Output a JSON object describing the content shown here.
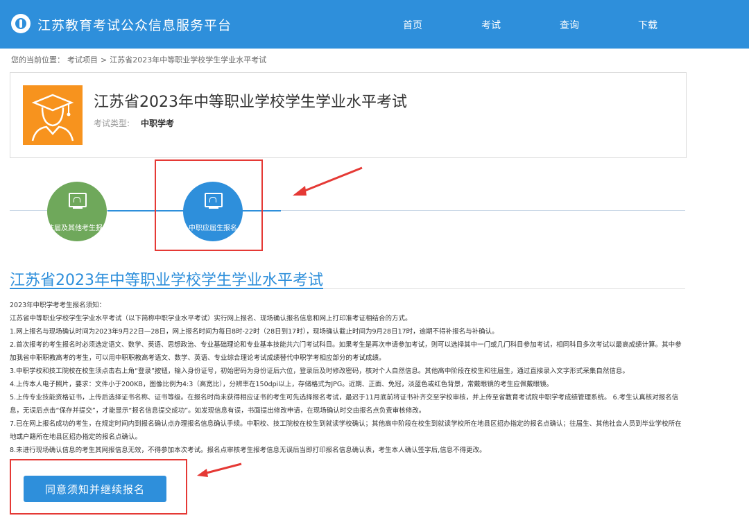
{
  "header": {
    "site_title": "江苏教育考试公众信息服务平台",
    "nav": [
      "首页",
      "考试",
      "查询",
      "下载"
    ]
  },
  "breadcrumb": {
    "prefix": "您的当前位置：",
    "item1": "考试项目",
    "sep": ">",
    "current": "江苏省2023年中等职业学校学生学业水平考试"
  },
  "exam": {
    "title": "江苏省2023年中等职业学校学生学业水平考试",
    "type_label": "考试类型:",
    "type_value": "中职学考"
  },
  "options": [
    {
      "label": "往届及其他考生报名"
    },
    {
      "label": "中职应届生报名"
    }
  ],
  "section_title": "江苏省2023年中等职业学校学生学业水平考试",
  "notice": [
    "2023年中职学考考生报名须知：",
    "江苏省中等职业学校学生学业水平考试（以下简称中职学业水平考试）实行网上报名、现场确认报名信息和网上打印准考证相结合的方式。",
    "1.网上报名与现场确认时间为2023年9月22日—28日，网上报名时间为每日8时-22时（28日到17时），现场确认截止时间为9月28日17时，逾期不得补报名与补确认。",
    "2.首次报考的考生报名时必须选定语文、数学、英语、思想政治、专业基础理论和专业基本技能共六门考试科目。如果考生是再次申请参加考试，则可以选择其中一门或几门科目参加考试，相同科目多次考试以最高成绩计算。其中参加我省中职职教高考的考生，可以用中职职教高考语文、数学、英语、专业综合理论考试成绩替代中职学考相应部分的考试成绩。",
    "3.中职学校和技工院校在校生须点击右上角“登录”按钮，输入身份证号，初始密码为身份证后六位，登录后及时修改密码，核对个人自然信息。其他高中阶段在校生和往届生，通过直接录入文字形式采集自然信息。",
    "4.上传本人电子照片，要求：文件小于200KB，图像比例为4:3（高宽比），分辨率在150dpi以上，存储格式为JPG。近期、正面、免冠，淡蓝色或红色背景，常戴眼镜的考生应佩戴眼镜。",
    "5.上传专业技能资格证书，上传后选择证书名称、证书等级。在报名时尚未获得相应证书的考生可先选择报名考试，最迟于11月底前将证书补齐交至学校审核，并上传至省教育考试院中职学考成绩管理系统。 6.考生认真核对报名信息，无误后点击“保存并提交”，才能显示“报名信息提交成功”。如发现信息有误，书面提出修改申请，在现场确认时交由报名点负责审核修改。",
    "7.已在网上报名成功的考生，在规定时间内到报名确认点办理报名信息确认手续。中职校、技工院校在校生到就读学校确认；其他高中阶段在校生到就读学校所在地县区招办指定的报名点确认；往届生、其他社会人员到毕业学校所在地或户籍所在地县区招办指定的报名点确认。",
    "8.未进行现场确认信息的考生其网报信息无效，不得参加本次考试。报名点审核考生报考信息无误后当即打印报名信息确认表，考生本人确认签字后,信息不得更改。"
  ],
  "agree_button": "同意须知并继续报名",
  "colors": {
    "brand_blue": "#2e8fdb",
    "orange": "#f7931e",
    "green": "#6fa85b",
    "highlight_red": "#e53935"
  }
}
